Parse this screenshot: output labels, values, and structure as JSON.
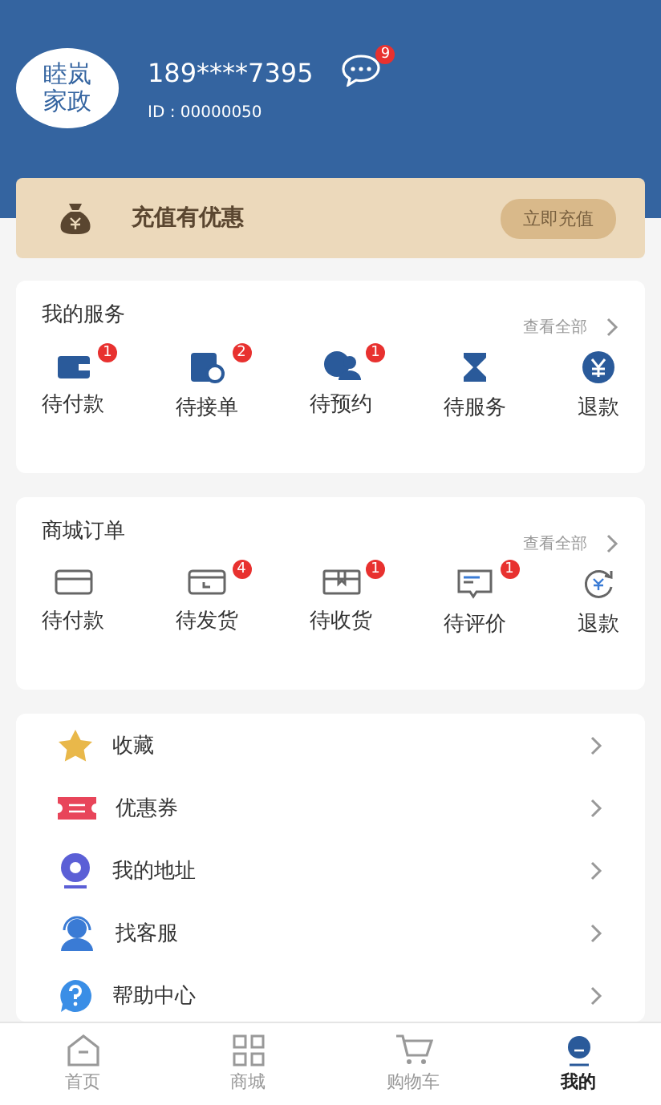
{
  "profile": {
    "logo": [
      "睦岚",
      "家政"
    ],
    "phone": "189****7395",
    "id": "ID : 00000050",
    "message_badge": "9"
  },
  "recharge": {
    "title": "充值有优惠",
    "button": "立即充值"
  },
  "sections": [
    {
      "title": "我的服务",
      "more": "查看全部",
      "items": [
        {
          "label": "待付款",
          "badge": "1"
        },
        {
          "label": "待接单",
          "badge": "2"
        },
        {
          "label": "待预约",
          "badge": "1"
        },
        {
          "label": "待服务"
        },
        {
          "label": "退款"
        }
      ]
    },
    {
      "title": "商城订单",
      "more": "查看全部",
      "items": [
        {
          "label": "待付款"
        },
        {
          "label": "待发货",
          "badge": "4"
        },
        {
          "label": "待收货",
          "badge": "1"
        },
        {
          "label": "待评价",
          "badge": "1"
        },
        {
          "label": "退款"
        }
      ]
    }
  ],
  "menu": [
    "收藏",
    "优惠券",
    "我的地址",
    "找客服",
    "帮助中心"
  ],
  "tabbar": [
    {
      "label": "首页",
      "selected": false
    },
    {
      "label": "商城",
      "selected": false
    },
    {
      "label": "购物车",
      "selected": false
    },
    {
      "label": "我的",
      "selected": true
    }
  ]
}
